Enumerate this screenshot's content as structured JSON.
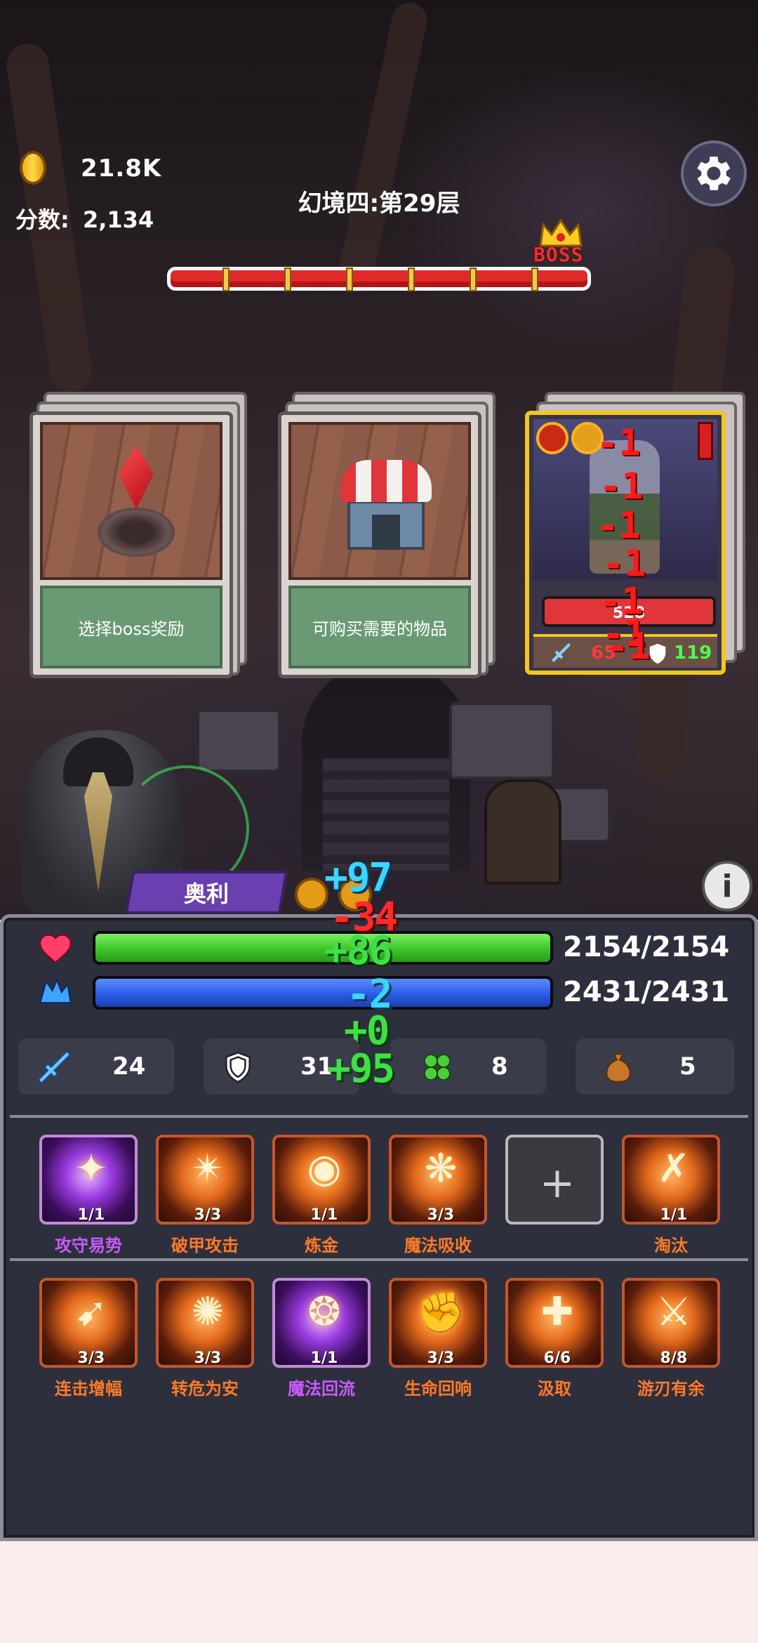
{
  "hud": {
    "coins": "21.8K",
    "score_label": "分数:",
    "score_value": "2,134",
    "level_title": "幻境四:第29层",
    "boss_label": "BOSS",
    "progress_markers": 6,
    "settings_icon": "gear-icon"
  },
  "cards": [
    {
      "label": "选择boss奖励",
      "icon": "red-crystal-icon"
    },
    {
      "label": "可购买需要的物品",
      "icon": "shop-icon"
    }
  ],
  "boss_card": {
    "attack": "65",
    "defense": "119",
    "hp_text": "528",
    "damage_numbers": [
      "-1",
      "-1",
      "-1",
      "-1",
      "-1",
      "-1",
      "-1"
    ]
  },
  "hero": {
    "name": "奥利",
    "floating_numbers": [
      {
        "text": "+97",
        "color": "cyan"
      },
      {
        "text": "-34",
        "color": "red"
      },
      {
        "text": "+86",
        "color": "green"
      },
      {
        "text": "-2",
        "color": "cyan"
      },
      {
        "text": "+0",
        "color": "green"
      },
      {
        "text": "+95",
        "color": "green"
      }
    ]
  },
  "status": {
    "hp": {
      "text": "2154/2154",
      "fraction": 1.0,
      "icon": "heart-icon",
      "color": "#3ec42a"
    },
    "mp": {
      "text": "2431/2431",
      "fraction": 1.0,
      "icon": "mana-icon",
      "color": "#2a5ce6"
    }
  },
  "stats": [
    {
      "icon": "sword-icon",
      "value": "24"
    },
    {
      "icon": "shield-icon",
      "value": "31"
    },
    {
      "icon": "clover-icon",
      "value": "8"
    },
    {
      "icon": "money-bag-icon",
      "value": "5"
    }
  ],
  "skills_row1": [
    {
      "name": "攻守易势",
      "count": "1/1",
      "style": "purple",
      "glyph": "✦"
    },
    {
      "name": "破甲攻击",
      "count": "3/3",
      "style": "orange",
      "glyph": "✴"
    },
    {
      "name": "炼金",
      "count": "1/1",
      "style": "orange",
      "glyph": "◉"
    },
    {
      "name": "魔法吸收",
      "count": "3/3",
      "style": "orange",
      "glyph": "❋"
    },
    {
      "name": "",
      "count": "",
      "style": "empty",
      "glyph": "+"
    },
    {
      "name": "淘汰",
      "count": "1/1",
      "style": "orange",
      "glyph": "✗"
    }
  ],
  "skills_row2": [
    {
      "name": "连击增幅",
      "count": "3/3",
      "style": "orange",
      "glyph": "➹"
    },
    {
      "name": "转危为安",
      "count": "3/3",
      "style": "orange",
      "glyph": "✺"
    },
    {
      "name": "魔法回流",
      "count": "1/1",
      "style": "purple",
      "glyph": "❂"
    },
    {
      "name": "生命回响",
      "count": "3/3",
      "style": "orange",
      "glyph": "✊"
    },
    {
      "name": "汲取",
      "count": "6/6",
      "style": "orange",
      "glyph": "✚"
    },
    {
      "name": "游刃有余",
      "count": "8/8",
      "style": "orange",
      "glyph": "⚔"
    }
  ]
}
